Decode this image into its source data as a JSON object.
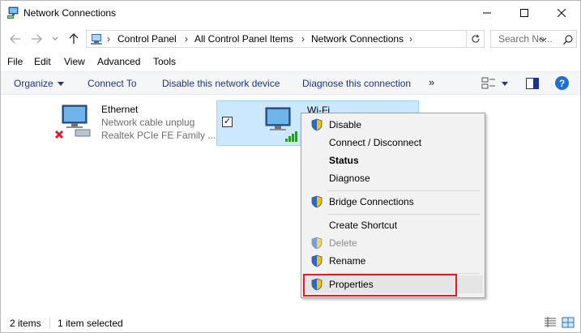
{
  "window": {
    "title": "Network Connections",
    "icons": {
      "app": "network-connections-icon",
      "minimize": "minimize-icon",
      "maximize": "maximize-icon",
      "close": "close-icon"
    }
  },
  "navigation": {
    "back_icon": "back-arrow-icon",
    "forward_icon": "forward-arrow-icon",
    "recent_icon": "chevron-down-icon",
    "up_icon": "up-arrow-icon",
    "breadcrumbs": [
      "Control Panel",
      "All Control Panel Items",
      "Network Connections"
    ],
    "search_placeholder": "Search Ne..."
  },
  "menu": {
    "items": [
      "File",
      "Edit",
      "View",
      "Advanced",
      "Tools"
    ]
  },
  "commandbar": {
    "organize": "Organize",
    "connect_to": "Connect To",
    "disable": "Disable this network device",
    "diagnose": "Diagnose this connection",
    "more": "»"
  },
  "connections": [
    {
      "name": "Ethernet",
      "status": "Network cable unplug",
      "device": "Realtek PCIe FE Family ...",
      "selected": false
    },
    {
      "name": "Wi-Fi",
      "selected": true
    }
  ],
  "context_menu": {
    "items": [
      {
        "label": "Disable",
        "shield": true,
        "style": "normal"
      },
      {
        "label": "Connect / Disconnect",
        "shield": false,
        "style": "normal"
      },
      {
        "label": "Status",
        "shield": false,
        "style": "bold"
      },
      {
        "label": "Diagnose",
        "shield": false,
        "style": "normal"
      },
      {
        "label": "Bridge Connections",
        "shield": true,
        "style": "normal"
      },
      {
        "label": "Create Shortcut",
        "shield": false,
        "style": "normal"
      },
      {
        "label": "Delete",
        "shield": true,
        "style": "disabled"
      },
      {
        "label": "Rename",
        "shield": true,
        "style": "normal"
      },
      {
        "label": "Properties",
        "shield": true,
        "style": "hover"
      }
    ],
    "highlighted": "Properties",
    "highlight_color": "#e01c24"
  },
  "status": {
    "count": "2 items",
    "selection": "1 item selected"
  },
  "colors": {
    "command_text": "#1e3287",
    "selection_bg": "#cce8ff",
    "selection_border": "#99d1ff"
  }
}
